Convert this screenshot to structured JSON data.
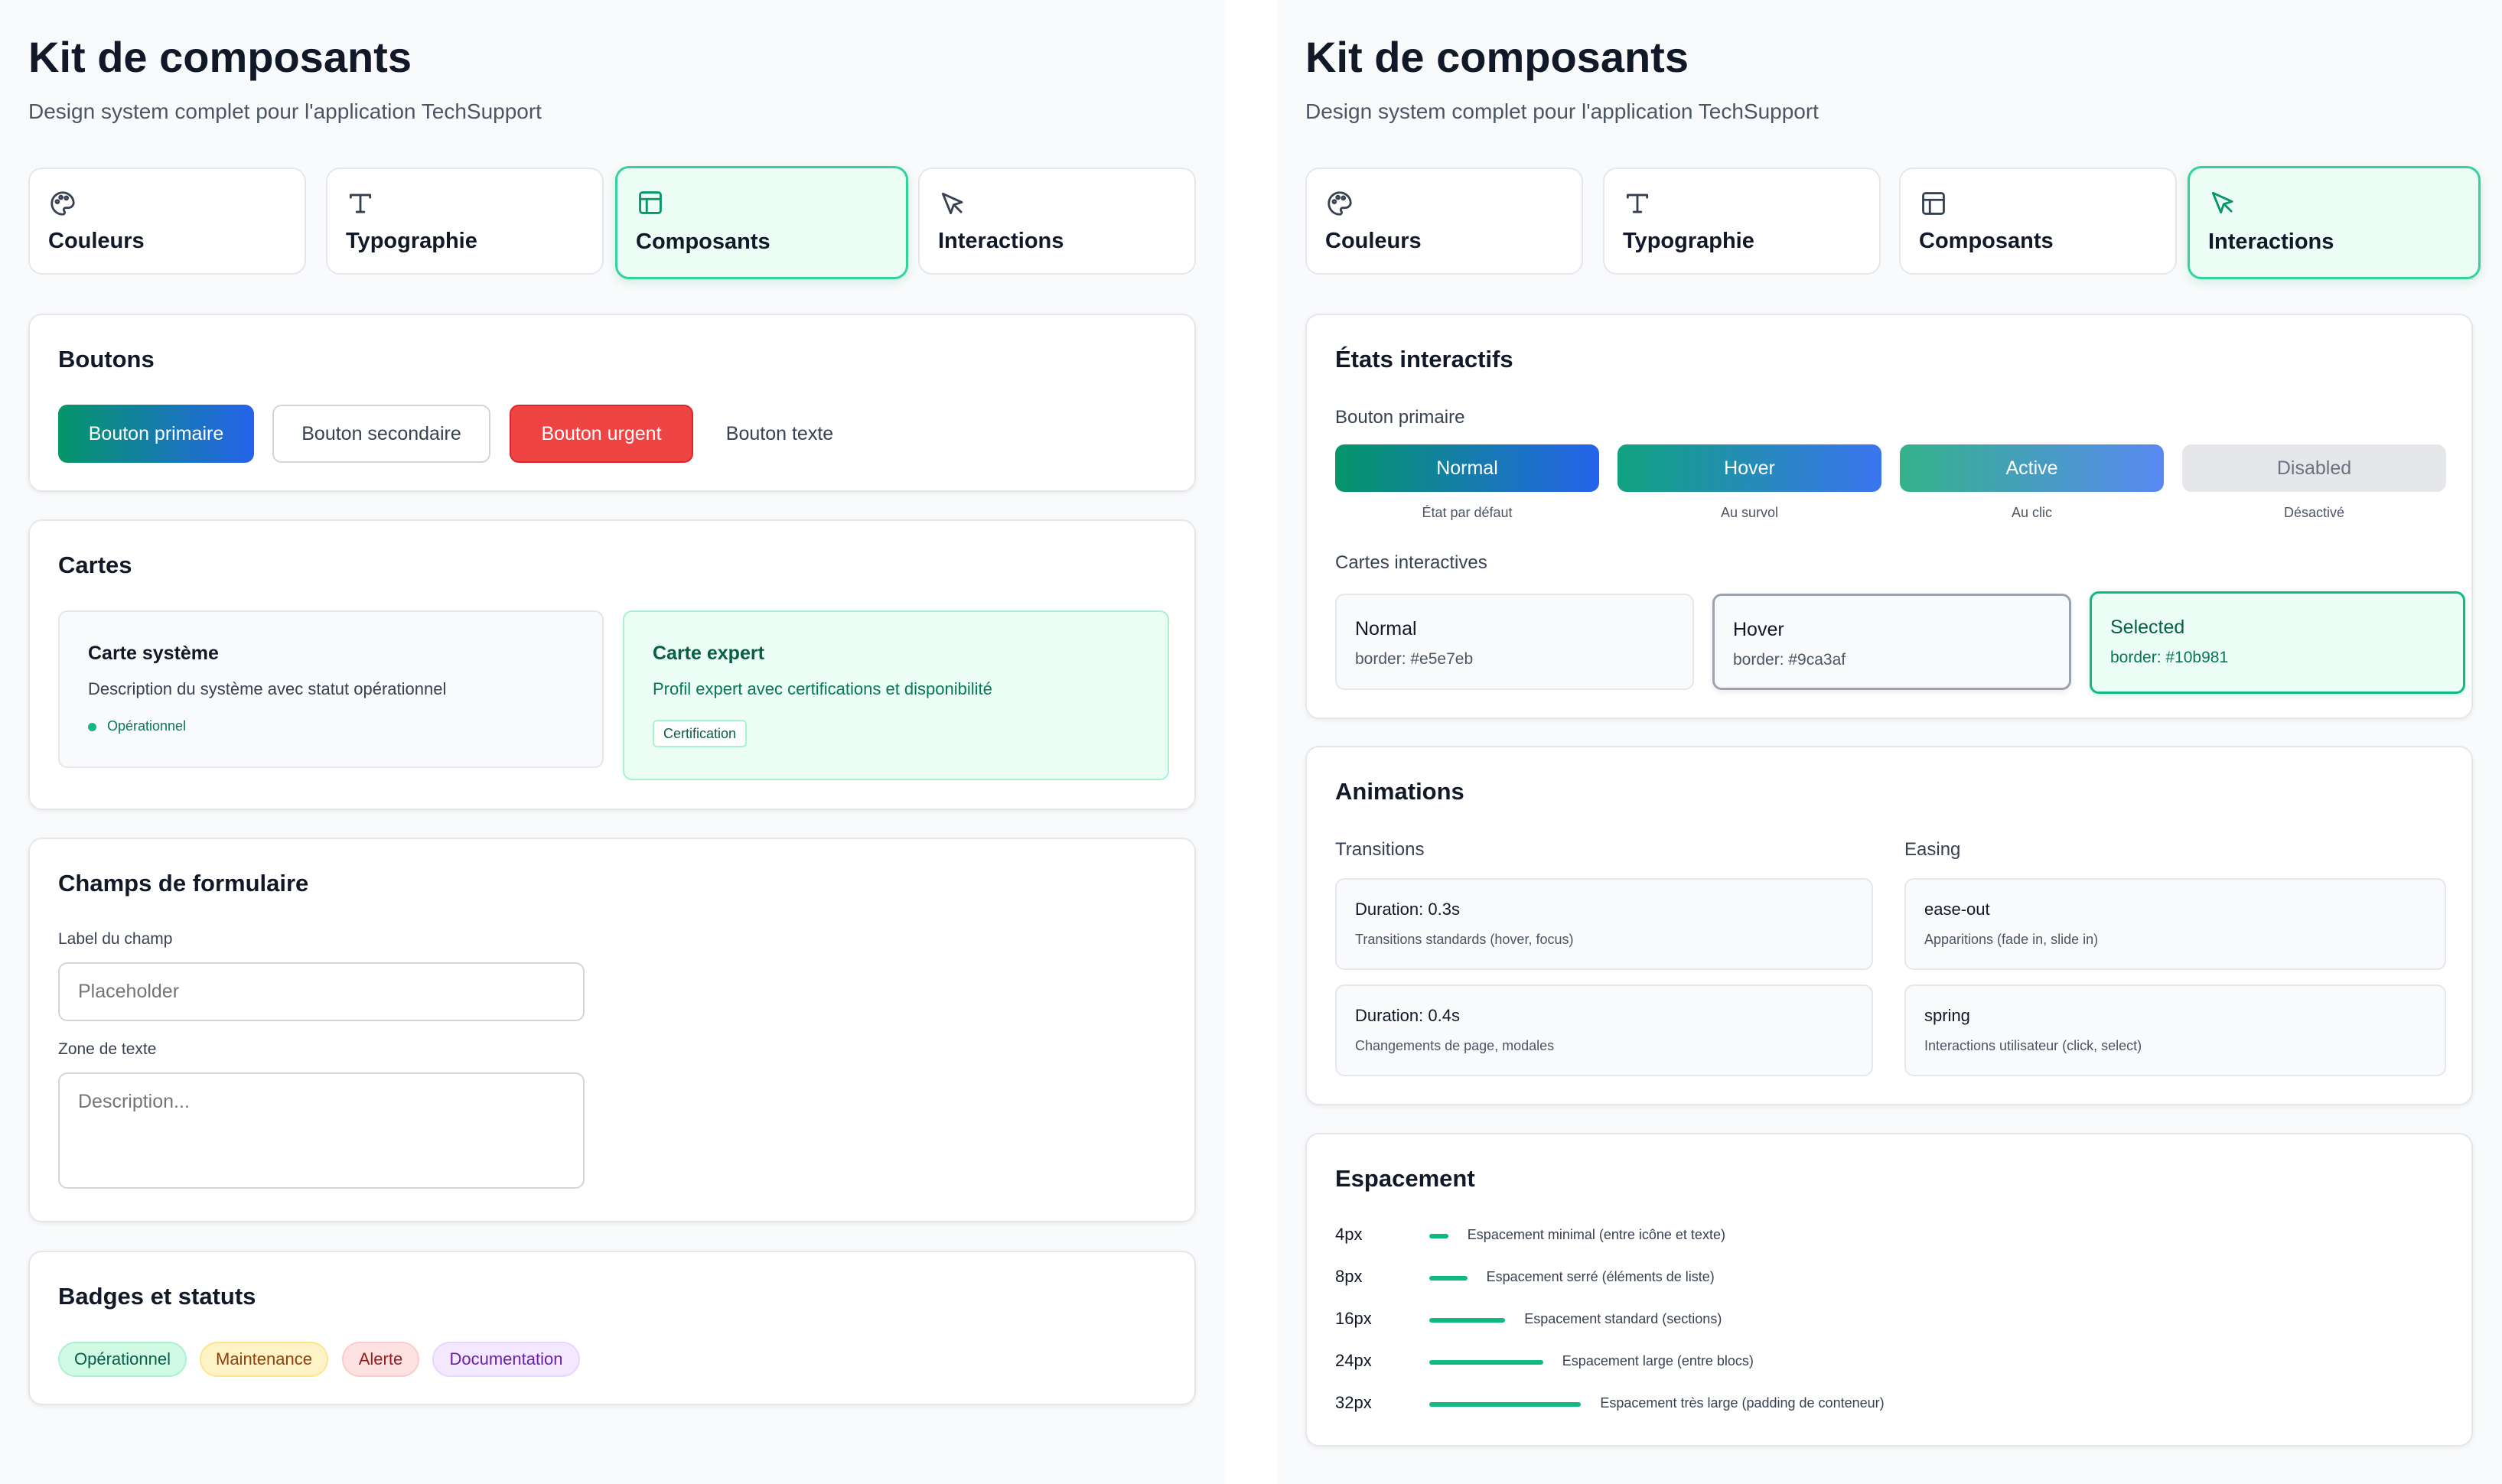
{
  "colors": {
    "accent": "#10b981",
    "accent_light": "#ecfdf5",
    "blue": "#2563eb",
    "red": "#ef4444"
  },
  "left": {
    "title": "Kit de composants",
    "subtitle": "Design system complet pour l'application TechSupport",
    "tabs": [
      {
        "label": "Couleurs",
        "icon": "palette-icon"
      },
      {
        "label": "Typographie",
        "icon": "type-icon"
      },
      {
        "label": "Composants",
        "icon": "layout-icon",
        "active": true
      },
      {
        "label": "Interactions",
        "icon": "cursor-icon"
      }
    ],
    "buttons": {
      "title": "Boutons",
      "primary": "Bouton primaire",
      "secondary": "Bouton secondaire",
      "urgent": "Bouton urgent",
      "text": "Bouton texte"
    },
    "cards": {
      "title": "Cartes",
      "system": {
        "title": "Carte système",
        "desc": "Description du système avec statut opérationnel",
        "status": "Opérationnel"
      },
      "expert": {
        "title": "Carte expert",
        "desc": "Profil expert avec certifications et disponibilité",
        "tag": "Certification"
      }
    },
    "form": {
      "title": "Champs de formulaire",
      "field_label": "Label du champ",
      "field_placeholder": "Placeholder",
      "textarea_label": "Zone de texte",
      "textarea_placeholder": "Description..."
    },
    "badges": {
      "title": "Badges et statuts",
      "items": [
        "Opérationnel",
        "Maintenance",
        "Alerte",
        "Documentation"
      ]
    }
  },
  "right": {
    "title": "Kit de composants",
    "subtitle": "Design system complet pour l'application TechSupport",
    "tabs": [
      {
        "label": "Couleurs",
        "icon": "palette-icon"
      },
      {
        "label": "Typographie",
        "icon": "type-icon"
      },
      {
        "label": "Composants",
        "icon": "layout-icon"
      },
      {
        "label": "Interactions",
        "icon": "cursor-icon",
        "active": true
      }
    ],
    "states": {
      "title": "États interactifs",
      "button_label": "Bouton primaire",
      "buttons": [
        {
          "label": "Normal",
          "caption": "État par défaut"
        },
        {
          "label": "Hover",
          "caption": "Au survol"
        },
        {
          "label": "Active",
          "caption": "Au clic"
        },
        {
          "label": "Disabled",
          "caption": "Désactivé"
        }
      ],
      "cards_label": "Cartes interactives",
      "cards": [
        {
          "label": "Normal",
          "border": "border: #e5e7eb"
        },
        {
          "label": "Hover",
          "border": "border: #9ca3af"
        },
        {
          "label": "Selected",
          "border": "border: #10b981"
        }
      ]
    },
    "animations": {
      "title": "Animations",
      "transitions_label": "Transitions",
      "easing_label": "Easing",
      "transitions": [
        {
          "title": "Duration: 0.3s",
          "desc": "Transitions standards (hover, focus)"
        },
        {
          "title": "Duration: 0.4s",
          "desc": "Changements de page, modales"
        }
      ],
      "easing": [
        {
          "title": "ease-out",
          "desc": "Apparitions (fade in, slide in)"
        },
        {
          "title": "spring",
          "desc": "Interactions utilisateur (click, select)"
        }
      ]
    },
    "spacing": {
      "title": "Espacement",
      "rows": [
        {
          "label": "4px",
          "value": 4,
          "desc": "Espacement minimal (entre icône et texte)"
        },
        {
          "label": "8px",
          "value": 8,
          "desc": "Espacement serré (éléments de liste)"
        },
        {
          "label": "16px",
          "value": 16,
          "desc": "Espacement standard (sections)"
        },
        {
          "label": "24px",
          "value": 24,
          "desc": "Espacement large (entre blocs)"
        },
        {
          "label": "32px",
          "value": 32,
          "desc": "Espacement très large (padding de conteneur)"
        }
      ]
    }
  }
}
